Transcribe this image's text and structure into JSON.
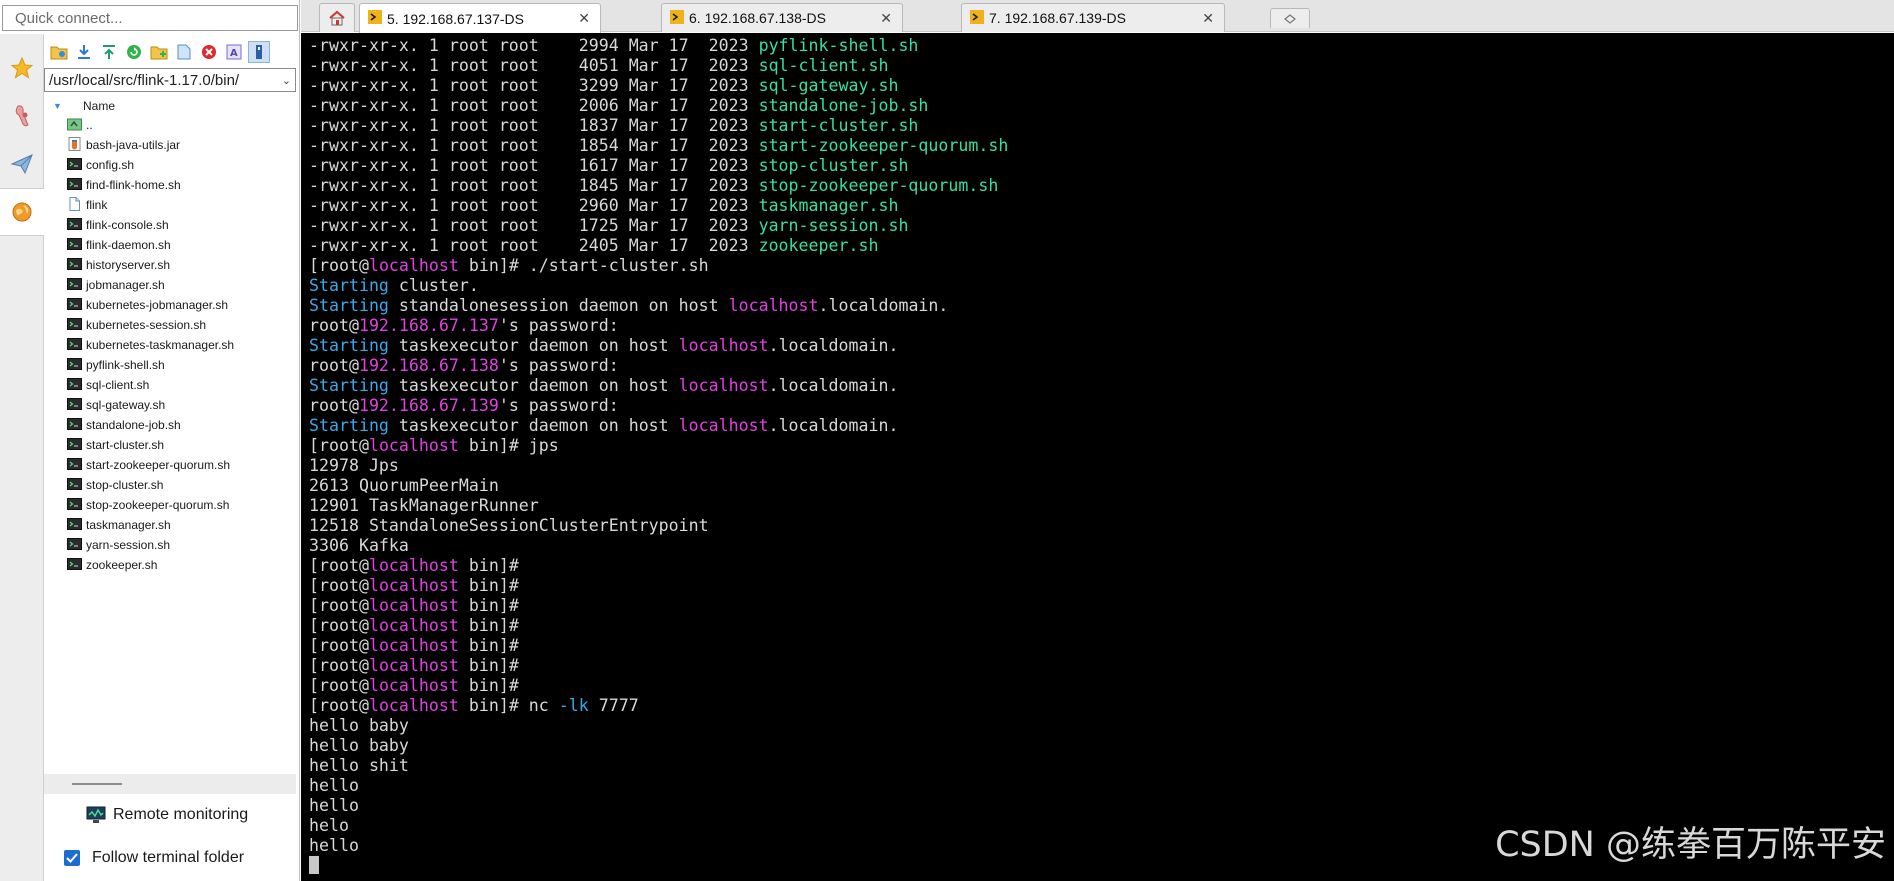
{
  "quick_connect": {
    "placeholder": "Quick connect..."
  },
  "sftp": {
    "path": "/usr/local/src/flink-1.17.0/bin/",
    "tree_header": "Name",
    "files": [
      {
        "name": "..",
        "icon": "parent-folder-icon"
      },
      {
        "name": "bash-java-utils.jar",
        "icon": "jar-file-icon"
      },
      {
        "name": "config.sh",
        "icon": "shell-script-icon"
      },
      {
        "name": "find-flink-home.sh",
        "icon": "shell-script-icon"
      },
      {
        "name": "flink",
        "icon": "file-icon"
      },
      {
        "name": "flink-console.sh",
        "icon": "shell-script-icon"
      },
      {
        "name": "flink-daemon.sh",
        "icon": "shell-script-icon"
      },
      {
        "name": "historyserver.sh",
        "icon": "shell-script-icon"
      },
      {
        "name": "jobmanager.sh",
        "icon": "shell-script-icon"
      },
      {
        "name": "kubernetes-jobmanager.sh",
        "icon": "shell-script-icon"
      },
      {
        "name": "kubernetes-session.sh",
        "icon": "shell-script-icon"
      },
      {
        "name": "kubernetes-taskmanager.sh",
        "icon": "shell-script-icon"
      },
      {
        "name": "pyflink-shell.sh",
        "icon": "shell-script-icon"
      },
      {
        "name": "sql-client.sh",
        "icon": "shell-script-icon"
      },
      {
        "name": "sql-gateway.sh",
        "icon": "shell-script-icon"
      },
      {
        "name": "standalone-job.sh",
        "icon": "shell-script-icon"
      },
      {
        "name": "start-cluster.sh",
        "icon": "shell-script-icon"
      },
      {
        "name": "start-zookeeper-quorum.sh",
        "icon": "shell-script-icon"
      },
      {
        "name": "stop-cluster.sh",
        "icon": "shell-script-icon"
      },
      {
        "name": "stop-zookeeper-quorum.sh",
        "icon": "shell-script-icon"
      },
      {
        "name": "taskmanager.sh",
        "icon": "shell-script-icon"
      },
      {
        "name": "yarn-session.sh",
        "icon": "shell-script-icon"
      },
      {
        "name": "zookeeper.sh",
        "icon": "shell-script-icon"
      }
    ],
    "remote_monitoring_label": "Remote monitoring",
    "follow_terminal_folder_label": "Follow terminal folder",
    "follow_terminal_folder_checked": true
  },
  "tabs": [
    {
      "label": "5. 192.168.67.137-DS",
      "active": true,
      "close": "✕"
    },
    {
      "label": "6. 192.168.67.138-DS",
      "active": false,
      "close": "✕"
    },
    {
      "label": "7. 192.168.67.139-DS",
      "active": false,
      "close": "✕"
    }
  ],
  "terminal": {
    "lines": [
      [
        [
          "-rwxr-xr-x. 1 root root    2994 Mar 17  2023 ",
          ""
        ],
        [
          "pyflink-shell.sh",
          "green"
        ]
      ],
      [
        [
          "-rwxr-xr-x. 1 root root    4051 Mar 17  2023 ",
          ""
        ],
        [
          "sql-client.sh",
          "green"
        ]
      ],
      [
        [
          "-rwxr-xr-x. 1 root root    3299 Mar 17  2023 ",
          ""
        ],
        [
          "sql-gateway.sh",
          "green"
        ]
      ],
      [
        [
          "-rwxr-xr-x. 1 root root    2006 Mar 17  2023 ",
          ""
        ],
        [
          "standalone-job.sh",
          "green"
        ]
      ],
      [
        [
          "-rwxr-xr-x. 1 root root    1837 Mar 17  2023 ",
          ""
        ],
        [
          "start-cluster.sh",
          "green"
        ]
      ],
      [
        [
          "-rwxr-xr-x. 1 root root    1854 Mar 17  2023 ",
          ""
        ],
        [
          "start-zookeeper-quorum.sh",
          "green"
        ]
      ],
      [
        [
          "-rwxr-xr-x. 1 root root    1617 Mar 17  2023 ",
          ""
        ],
        [
          "stop-cluster.sh",
          "green"
        ]
      ],
      [
        [
          "-rwxr-xr-x. 1 root root    1845 Mar 17  2023 ",
          ""
        ],
        [
          "stop-zookeeper-quorum.sh",
          "green"
        ]
      ],
      [
        [
          "-rwxr-xr-x. 1 root root    2960 Mar 17  2023 ",
          ""
        ],
        [
          "taskmanager.sh",
          "green"
        ]
      ],
      [
        [
          "-rwxr-xr-x. 1 root root    1725 Mar 17  2023 ",
          ""
        ],
        [
          "yarn-session.sh",
          "green"
        ]
      ],
      [
        [
          "-rwxr-xr-x. 1 root root    2405 Mar 17  2023 ",
          ""
        ],
        [
          "zookeeper.sh",
          "green"
        ]
      ],
      [
        [
          "[root@",
          ""
        ],
        [
          "localhost",
          "magenta"
        ],
        [
          " bin]# ./start-cluster.sh",
          ""
        ]
      ],
      [
        [
          "Starting",
          "blue"
        ],
        [
          " cluster.",
          ""
        ]
      ],
      [
        [
          "Starting",
          "blue"
        ],
        [
          " standalonesession daemon on host ",
          ""
        ],
        [
          "localhost",
          "magenta"
        ],
        [
          ".localdomain.",
          ""
        ]
      ],
      [
        [
          "root@",
          ""
        ],
        [
          "192.168.67.137",
          "magenta"
        ],
        [
          "'s password:",
          ""
        ]
      ],
      [
        [
          "Starting",
          "blue"
        ],
        [
          " taskexecutor daemon on host ",
          ""
        ],
        [
          "localhost",
          "magenta"
        ],
        [
          ".localdomain.",
          ""
        ]
      ],
      [
        [
          "root@",
          ""
        ],
        [
          "192.168.67.138",
          "magenta"
        ],
        [
          "'s password:",
          ""
        ]
      ],
      [
        [
          "Starting",
          "blue"
        ],
        [
          " taskexecutor daemon on host ",
          ""
        ],
        [
          "localhost",
          "magenta"
        ],
        [
          ".localdomain.",
          ""
        ]
      ],
      [
        [
          "root@",
          ""
        ],
        [
          "192.168.67.139",
          "magenta"
        ],
        [
          "'s password:",
          ""
        ]
      ],
      [
        [
          "Starting",
          "blue"
        ],
        [
          " taskexecutor daemon on host ",
          ""
        ],
        [
          "localhost",
          "magenta"
        ],
        [
          ".localdomain.",
          ""
        ]
      ],
      [
        [
          "[root@",
          ""
        ],
        [
          "localhost",
          "magenta"
        ],
        [
          " bin]# jps",
          ""
        ]
      ],
      [
        [
          "12978 Jps",
          ""
        ]
      ],
      [
        [
          "2613 QuorumPeerMain",
          ""
        ]
      ],
      [
        [
          "12901 TaskManagerRunner",
          ""
        ]
      ],
      [
        [
          "12518 StandaloneSessionClusterEntrypoint",
          ""
        ]
      ],
      [
        [
          "3306 Kafka",
          ""
        ]
      ],
      [
        [
          "[root@",
          ""
        ],
        [
          "localhost",
          "magenta"
        ],
        [
          " bin]#",
          ""
        ]
      ],
      [
        [
          "[root@",
          ""
        ],
        [
          "localhost",
          "magenta"
        ],
        [
          " bin]#",
          ""
        ]
      ],
      [
        [
          "[root@",
          ""
        ],
        [
          "localhost",
          "magenta"
        ],
        [
          " bin]#",
          ""
        ]
      ],
      [
        [
          "[root@",
          ""
        ],
        [
          "localhost",
          "magenta"
        ],
        [
          " bin]#",
          ""
        ]
      ],
      [
        [
          "[root@",
          ""
        ],
        [
          "localhost",
          "magenta"
        ],
        [
          " bin]#",
          ""
        ]
      ],
      [
        [
          "[root@",
          ""
        ],
        [
          "localhost",
          "magenta"
        ],
        [
          " bin]#",
          ""
        ]
      ],
      [
        [
          "[root@",
          ""
        ],
        [
          "localhost",
          "magenta"
        ],
        [
          " bin]#",
          ""
        ]
      ],
      [
        [
          "[root@",
          ""
        ],
        [
          "localhost",
          "magenta"
        ],
        [
          " bin]# nc ",
          ""
        ],
        [
          "-lk",
          "blue"
        ],
        [
          " 7777",
          ""
        ]
      ],
      [
        [
          "hello baby",
          ""
        ]
      ],
      [
        [
          "hello baby",
          ""
        ]
      ],
      [
        [
          "hello shit",
          ""
        ]
      ],
      [
        [
          "hello",
          ""
        ]
      ],
      [
        [
          "hello",
          ""
        ]
      ],
      [
        [
          "helo",
          ""
        ]
      ],
      [
        [
          "hello",
          ""
        ]
      ]
    ]
  },
  "watermark": "CSDN @练拳百万陈平安",
  "colors": {
    "terminal_bg": "#000000",
    "terminal_fg": "#d8d8d8",
    "executable_green": "#35e0a0",
    "host_magenta": "#e040e0",
    "keyword_blue": "#3aa8e8",
    "accent_blue": "#1c6dd0"
  }
}
